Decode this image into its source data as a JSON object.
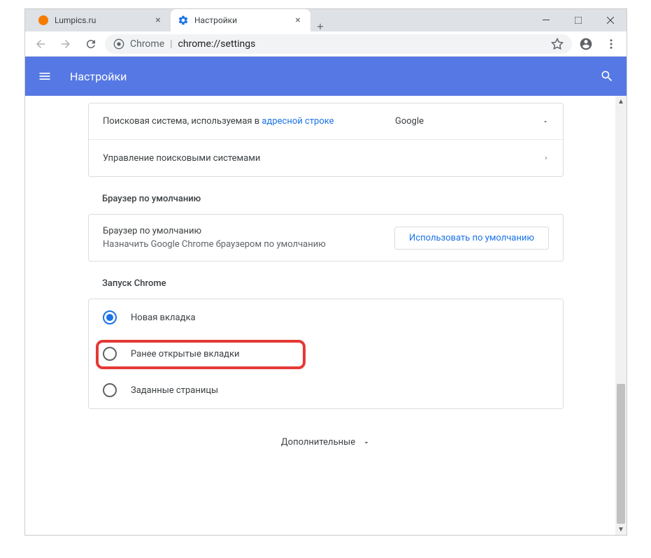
{
  "window": {
    "tabs": [
      {
        "title": "Lumpics.ru",
        "icon": "orange-favicon",
        "active": false
      },
      {
        "title": "Настройки",
        "icon": "settings-favicon",
        "active": true
      }
    ]
  },
  "address_bar": {
    "prefix": "Chrome",
    "path": "chrome://settings"
  },
  "topbar": {
    "title": "Настройки"
  },
  "search_engine": {
    "label_prefix": "Поисковая система, используемая в ",
    "label_link": "адресной строке",
    "value": "Google",
    "manage_label": "Управление поисковыми системами"
  },
  "default_browser": {
    "section_title": "Браузер по умолчанию",
    "row_title": "Браузер по умолчанию",
    "row_sub": "Назначить Google Chrome браузером по умолчанию",
    "button": "Использовать по умолчанию"
  },
  "startup": {
    "section_title": "Запуск Chrome",
    "options": [
      {
        "label": "Новая вкладка",
        "selected": true
      },
      {
        "label": "Ранее открытые вкладки",
        "selected": false
      },
      {
        "label": "Заданные страницы",
        "selected": false
      }
    ]
  },
  "advanced": {
    "label": "Дополнительные"
  }
}
